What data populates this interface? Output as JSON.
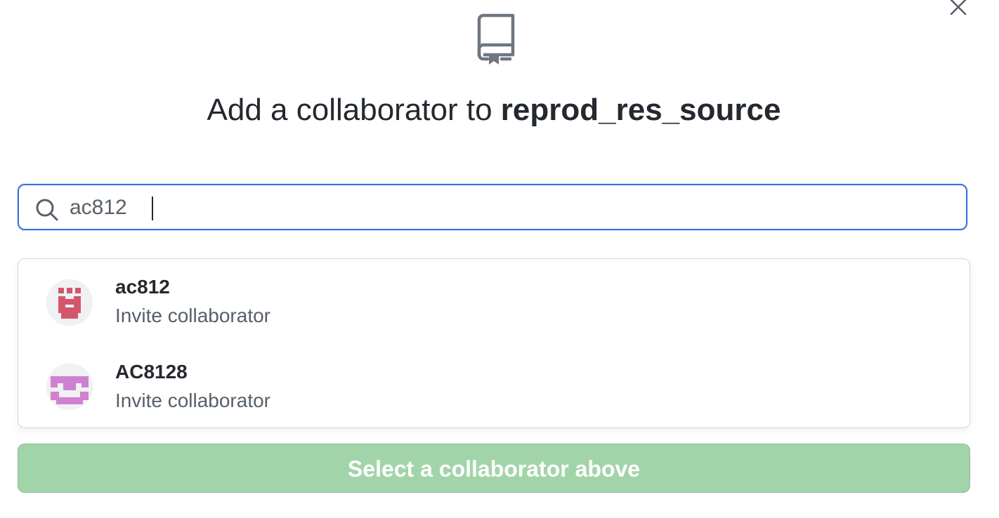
{
  "dialog": {
    "close_icon": "x-icon",
    "header_icon": "repo-icon",
    "title_prefix": "Add a collaborator to ",
    "repo_name": "reprod_res_source"
  },
  "search": {
    "icon": "search-icon",
    "value": "ac812",
    "border_color": "#3b6fd9"
  },
  "results": [
    {
      "login": "ac812",
      "action": "Invite collaborator",
      "avatar_color": "#d4566b"
    },
    {
      "login": "AC8128",
      "action": "Invite collaborator",
      "avatar_color": "#d080d0"
    }
  ],
  "submit": {
    "label": "Select a collaborator above",
    "disabled": true,
    "color": "#a2d4a9"
  }
}
